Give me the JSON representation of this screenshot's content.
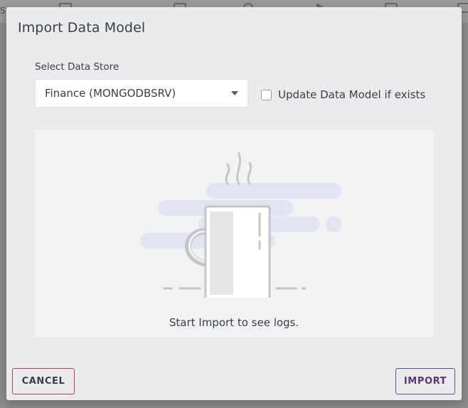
{
  "background": {
    "partial_text": "S"
  },
  "dialog": {
    "title": "Import Data Model",
    "data_store": {
      "label": "Select Data Store",
      "selected_value": "Finance (MONGODBSRV)"
    },
    "update_checkbox": {
      "label": "Update Data Model if exists",
      "checked": false
    },
    "logs": {
      "empty_message": "Start Import to see logs.",
      "illustration": "coffee-mug-icon"
    },
    "buttons": {
      "cancel_label": "CANCEL",
      "import_label": "IMPORT"
    }
  },
  "colors": {
    "dialog_background": "#eaebec",
    "cancel_border": "#c33b54",
    "import_border": "#6e4b85",
    "import_text": "#5a3575"
  }
}
